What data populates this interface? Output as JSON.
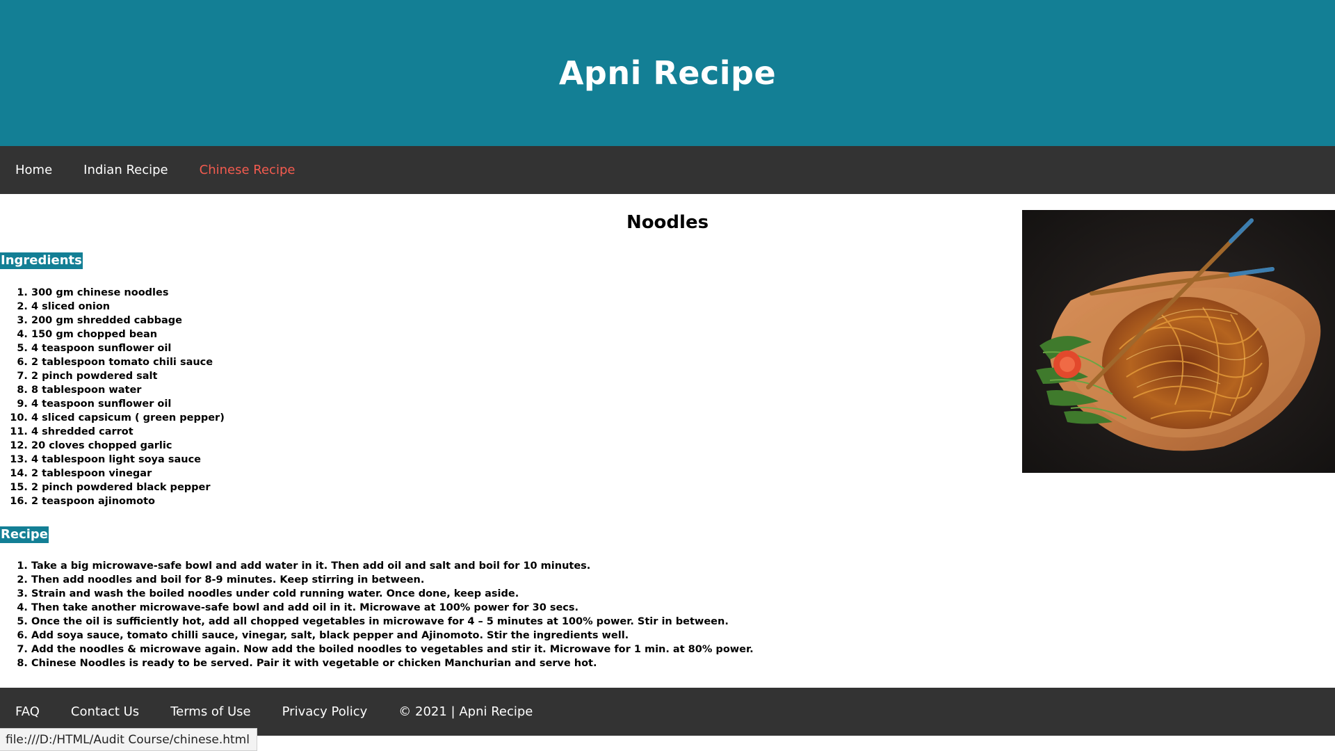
{
  "header": {
    "title": "Apni Recipe"
  },
  "nav": {
    "items": [
      {
        "label": "Home"
      },
      {
        "label": "Indian Recipe"
      },
      {
        "label": "Chinese Recipe"
      }
    ]
  },
  "main": {
    "title": "Noodles",
    "ingredients_label": "Ingredients",
    "ingredients": [
      "300 gm chinese noodles",
      "4 sliced onion",
      "200 gm shredded cabbage",
      "150 gm chopped bean",
      "4 teaspoon sunflower oil",
      "2 tablespoon tomato chili sauce",
      "2 pinch powdered salt",
      "8 tablespoon water",
      "4 teaspoon sunflower oil",
      "4 sliced capsicum ( green pepper)",
      "4 shredded carrot",
      "20 cloves chopped garlic",
      "4 tablespoon light soya sauce",
      "2 tablespoon vinegar",
      "2 pinch powdered black pepper",
      "2 teaspoon ajinomoto"
    ],
    "recipe_label": "Recipe",
    "steps": [
      "Take a big microwave-safe bowl and add water in it. Then add oil and salt and boil for 10 minutes.",
      "Then add noodles and boil for 8-9 minutes. Keep stirring in between.",
      "Strain and wash the boiled noodles under cold running water. Once done, keep aside.",
      "Then take another microwave-safe bowl and add oil in it. Microwave at 100% power for 30 secs.",
      "Once the oil is sufficiently hot, add all chopped vegetables in microwave for 4 – 5 minutes at 100% power. Stir in between.",
      "Add soya sauce, tomato chilli sauce, vinegar, salt, black pepper and Ajinomoto. Stir the ingredients well.",
      "Add the noodles & microwave again. Now add the boiled noodles to vegetables and stir it. Microwave for 1 min. at 80% power.",
      "Chinese Noodles is ready to be served. Pair it with vegetable or chicken Manchurian and serve hot."
    ]
  },
  "footer": {
    "links": [
      {
        "label": "FAQ"
      },
      {
        "label": "Contact Us"
      },
      {
        "label": "Terms of Use"
      },
      {
        "label": "Privacy Policy"
      }
    ],
    "copyright": "© 2021 | Apni Recipe"
  },
  "statusbar": {
    "url": "file:///D:/HTML/Audit Course/chinese.html"
  },
  "colors": {
    "header_bg": "#137f95",
    "nav_bg": "#333333",
    "active_link": "#f35b4f",
    "label_bg": "#137f95"
  }
}
